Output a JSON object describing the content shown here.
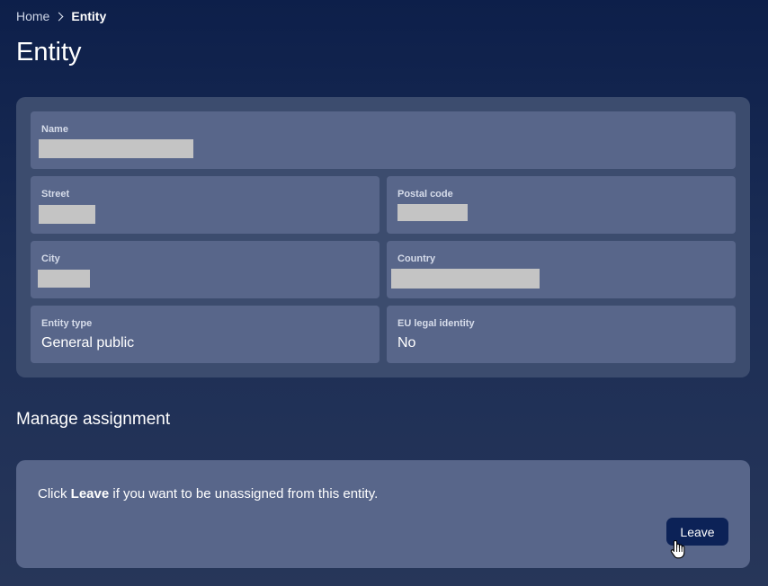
{
  "breadcrumb": {
    "home": "Home",
    "current": "Entity"
  },
  "page": {
    "title": "Entity"
  },
  "details": {
    "name_label": "Name",
    "street_label": "Street",
    "postal_label": "Postal code",
    "city_label": "City",
    "country_label": "Country",
    "entity_type_label": "Entity type",
    "entity_type_value": "General public",
    "eu_legal_label": "EU legal identity",
    "eu_legal_value": "No"
  },
  "assignment": {
    "title": "Manage assignment",
    "text_prefix": "Click ",
    "text_bold": "Leave",
    "text_suffix": " if you want to be unassigned from this entity.",
    "leave_label": "Leave"
  },
  "colors": {
    "accent": "#0c2257",
    "card": "#3c4c6e",
    "field": "#58668a"
  }
}
